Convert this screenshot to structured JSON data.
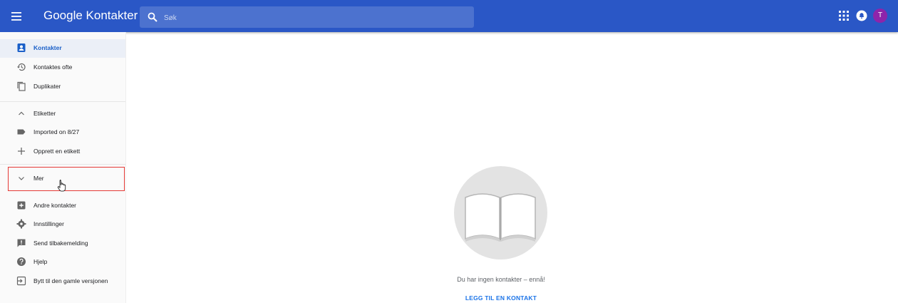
{
  "header": {
    "app_title": "Google Kontakter",
    "search_placeholder": "Søk",
    "avatar_initial": "T",
    "colors": {
      "bar": "#2a57c6",
      "avatar": "#8e24aa"
    },
    "icons": [
      "menu-icon",
      "search-icon",
      "apps-grid-icon",
      "notifications-icon"
    ]
  },
  "sidebar": {
    "items": [
      {
        "label": "Kontakter",
        "icon": "contacts-icon",
        "active": true
      },
      {
        "label": "Kontaktes ofte",
        "icon": "history-icon"
      },
      {
        "label": "Duplikater",
        "icon": "copy-icon"
      },
      {
        "label": "Etiketter",
        "icon": "chevron-up-icon"
      },
      {
        "label": "Imported on 8/27",
        "icon": "label-icon"
      },
      {
        "label": "Opprett en etikett",
        "icon": "plus-icon"
      },
      {
        "label": "Mer",
        "icon": "chevron-down-icon"
      },
      {
        "label": "Andre kontakter",
        "icon": "add-box-icon"
      },
      {
        "label": "Innstillinger",
        "icon": "settings-icon"
      },
      {
        "label": "Send tilbakemelding",
        "icon": "feedback-icon"
      },
      {
        "label": "Hjelp",
        "icon": "help-icon"
      },
      {
        "label": "Bytt til den gamle versjonen",
        "icon": "exit-icon"
      }
    ],
    "highlighted_item": "Mer",
    "colors": {
      "active_text": "#1a5fc8",
      "active_bg": "#ebeff7",
      "highlight": "#e53935"
    }
  },
  "main": {
    "empty_message": "Du har ingen kontakter – ennå!",
    "add_contact_label": "LEGG TIL EN KONTAKT",
    "illustration_icon": "open-book-icon",
    "colors": {
      "link": "#1a73e8"
    }
  }
}
